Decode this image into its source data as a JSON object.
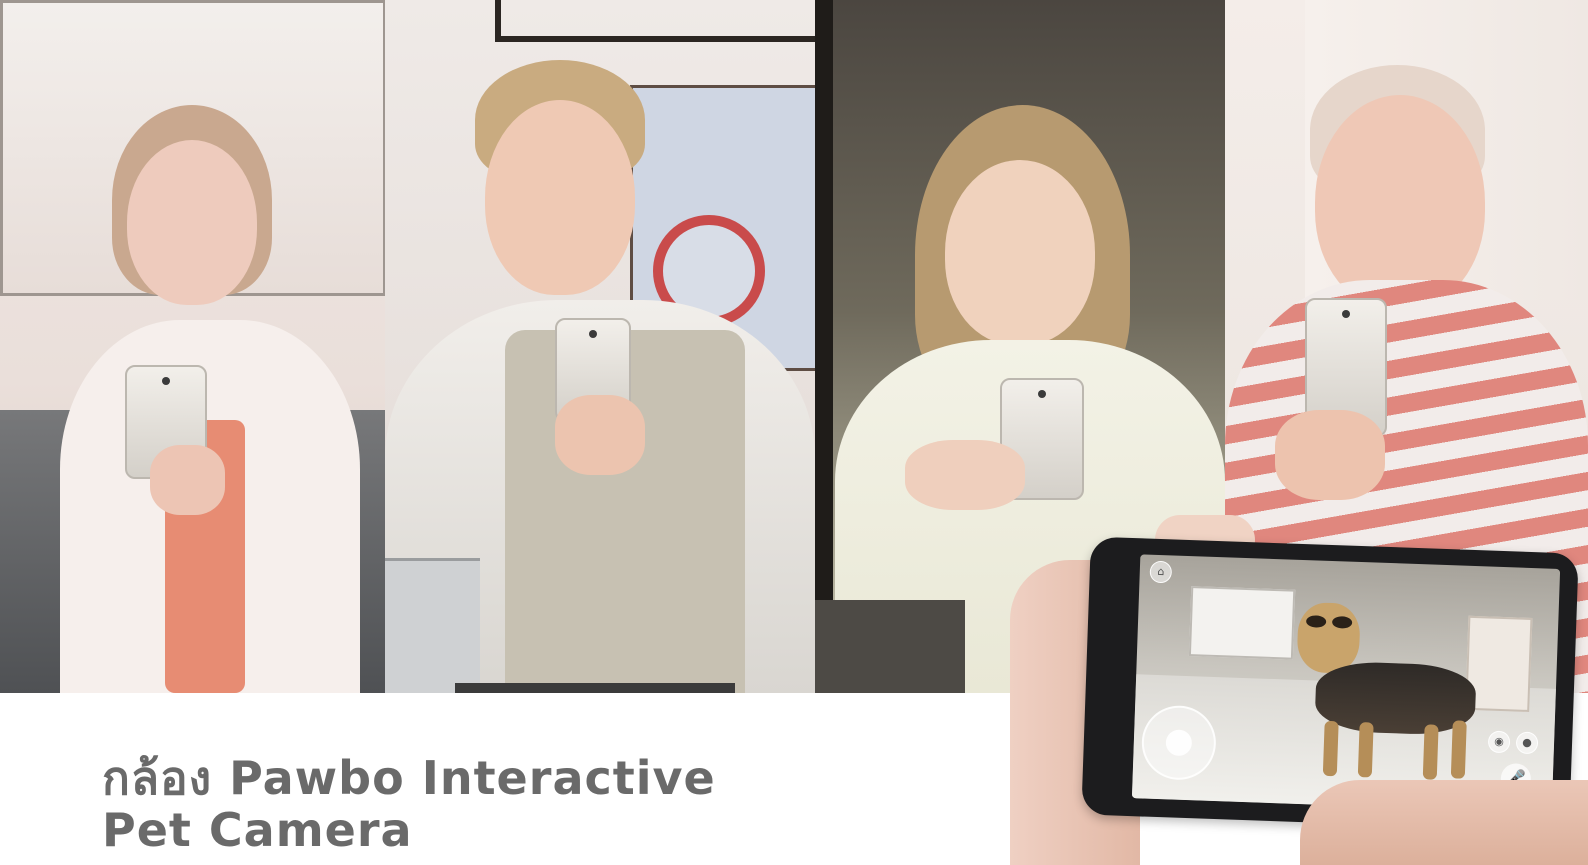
{
  "caption": {
    "line1": "กล้อง Pawbo Interactive",
    "line2": "Pet Camera"
  },
  "app_screen": {
    "mic_icon": "🎤",
    "home_icon": "⌂",
    "snapshot_icon": "◉",
    "record_icon": "●"
  },
  "colors": {
    "caption_text": "#6a6a6a",
    "phone_body": "#1c1c1e",
    "accent_red": "#c94b4b"
  }
}
